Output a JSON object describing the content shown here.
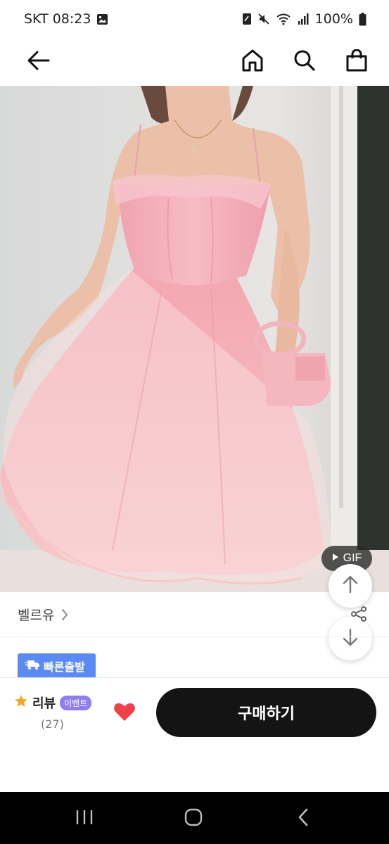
{
  "status_bar": {
    "carrier_time": "SKT 08:23",
    "battery": "100%",
    "icons": [
      "image-icon",
      "nfc-icon",
      "mute-icon",
      "wifi-icon",
      "signal-icon",
      "battery-icon"
    ]
  },
  "nav": {
    "icons": [
      "back-arrow-icon",
      "home-icon",
      "search-icon",
      "shopping-bag-icon"
    ]
  },
  "hero": {
    "gif_label": "GIF"
  },
  "brand": {
    "name": "벨르유"
  },
  "delivery": {
    "label": "빠른출발"
  },
  "buy_bar": {
    "review_label": "리뷰",
    "event_label": "이벤트",
    "review_count": "(27)",
    "buy_label": "구매하기"
  },
  "colors": {
    "delivery_badge": "#5b8af5",
    "event_badge": "#8f7df2",
    "heart": "#f0404a",
    "star": "#f5a623",
    "buy_button": "#141414"
  }
}
